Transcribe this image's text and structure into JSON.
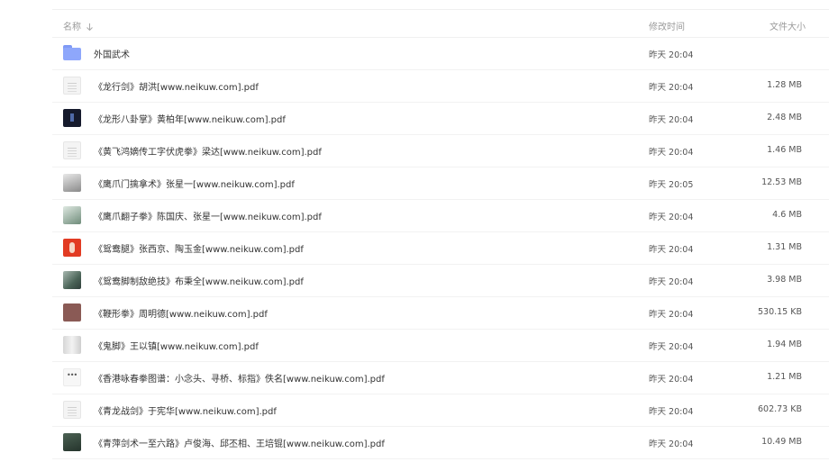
{
  "header": {
    "name_label": "名称",
    "time_label": "修改时间",
    "size_label": "文件大小"
  },
  "files": [
    {
      "name": "外国武术",
      "time": "昨天 20:04",
      "size": "",
      "thumb": "folder-icon"
    },
    {
      "name": "《龙行剑》胡洪[www.neikuw.com].pdf",
      "time": "昨天 20:04",
      "size": "1.28 MB",
      "thumb": "pdf-thumbnail"
    },
    {
      "name": "《龙形八卦掌》黄柏年[www.neikuw.com].pdf",
      "time": "昨天 20:04",
      "size": "2.48 MB",
      "thumb": "pdf-thumbnail"
    },
    {
      "name": "《黄飞鸿嫡传工字伏虎拳》梁达[www.neikuw.com].pdf",
      "time": "昨天 20:04",
      "size": "1.46 MB",
      "thumb": "pdf-thumbnail"
    },
    {
      "name": "《鹰爪门擒拿术》张星一[www.neikuw.com].pdf",
      "time": "昨天 20:05",
      "size": "12.53 MB",
      "thumb": "pdf-thumbnail"
    },
    {
      "name": "《鹰爪翻子拳》陈国庆、张星一[www.neikuw.com].pdf",
      "time": "昨天 20:04",
      "size": "4.6 MB",
      "thumb": "pdf-thumbnail"
    },
    {
      "name": "《鸳鸯腿》张西京、陶玉金[www.neikuw.com].pdf",
      "time": "昨天 20:04",
      "size": "1.31 MB",
      "thumb": "pdf-thumbnail"
    },
    {
      "name": "《鸳鸯脚制敌绝技》布秉全[www.neikuw.com].pdf",
      "time": "昨天 20:04",
      "size": "3.98 MB",
      "thumb": "pdf-thumbnail"
    },
    {
      "name": "《鞭形拳》周明德[www.neikuw.com].pdf",
      "time": "昨天 20:04",
      "size": "530.15 KB",
      "thumb": "pdf-thumbnail"
    },
    {
      "name": "《鬼脚》王以镇[www.neikuw.com].pdf",
      "time": "昨天 20:04",
      "size": "1.94 MB",
      "thumb": "pdf-thumbnail"
    },
    {
      "name": "《香港咏春拳图谱：小念头、寻桥、标指》佚名[www.neikuw.com].pdf",
      "time": "昨天 20:04",
      "size": "1.21 MB",
      "thumb": "pdf-thumbnail"
    },
    {
      "name": "《青龙战剑》于宪华[www.neikuw.com].pdf",
      "time": "昨天 20:04",
      "size": "602.73 KB",
      "thumb": "pdf-thumbnail"
    },
    {
      "name": "《青萍剑术一至六路》卢俊海、邱丕相、王培锟[www.neikuw.com].pdf",
      "time": "昨天 20:04",
      "size": "10.49 MB",
      "thumb": "pdf-thumbnail"
    }
  ]
}
